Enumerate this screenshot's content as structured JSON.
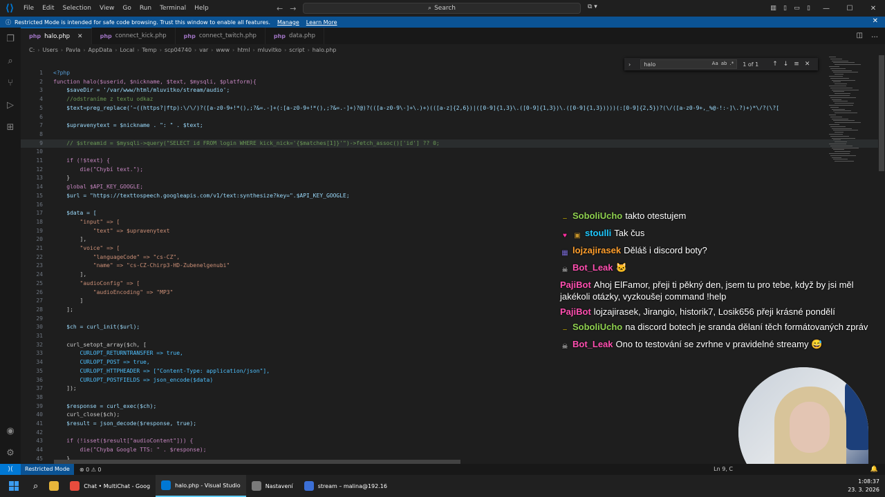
{
  "menu": [
    "File",
    "Edit",
    "Selection",
    "View",
    "Go",
    "Run",
    "Terminal",
    "Help"
  ],
  "search": {
    "label": "Search"
  },
  "banner": {
    "text": "Restricted Mode is intended for safe code browsing. Trust this window to enable all features.",
    "manage": "Manage",
    "learn_more": "Learn More"
  },
  "tabs": [
    {
      "label": "halo.php",
      "active": true
    },
    {
      "label": "connect_kick.php",
      "active": false
    },
    {
      "label": "connect_twitch.php",
      "active": false
    },
    {
      "label": "data.php",
      "active": false
    }
  ],
  "breadcrumb": [
    "C:",
    "Users",
    "Pavla",
    "AppData",
    "Local",
    "Temp",
    "scp04740",
    "var",
    "www",
    "html",
    "mluvitko",
    "script",
    "halo.php"
  ],
  "find": {
    "query": "halo",
    "count": "1 of 1",
    "opt_case": "Aa",
    "opt_word": "ab",
    "opt_regex": ".*"
  },
  "code_lines": [
    {
      "num": "1",
      "text": "<?php"
    },
    {
      "num": "2",
      "text": "function halo($userid, $nickname, $text, $mysqli, $platform){"
    },
    {
      "num": "3",
      "text": "    $saveDir = '/var/www/html/mluvitko/stream/audio';"
    },
    {
      "num": "4",
      "text": "    //odstraníme z textu odkaz"
    },
    {
      "num": "5",
      "text": "    $text=preg_replace('~((https?|ftp):\\/\\/)?([a-z0-9+!*(),;?&=.-]+(:[a-z0-9+!*(),;?&=.-]+)?@)?(([a-z0-9\\-]+\\.)+)(([a-z]{2,6})|([0-9]{1,3}\\.([0-9]{1,3})\\.([0-9]{1,3}))))(:[0-9]{2,5})?(\\/([a-z0-9+,_%@-!:-]\\.?)+)*\\/?(\\?["
    },
    {
      "num": "6",
      "text": ""
    },
    {
      "num": "7",
      "text": "    $upravenytext = $nickname . \": \" . $text;"
    },
    {
      "num": "8",
      "text": ""
    },
    {
      "num": "9",
      "text": "    // $streamid = $mysqli->query(\"SELECT id FROM login WHERE kick_nick='{$matches[1]}'\")->fetch_assoc()['id'] ?? 0;"
    },
    {
      "num": "10",
      "text": ""
    },
    {
      "num": "11",
      "text": "    if (!$text) {"
    },
    {
      "num": "12",
      "text": "        die(\"Chybí text.\");"
    },
    {
      "num": "13",
      "text": "    }"
    },
    {
      "num": "14",
      "text": "    global $API_KEY_GOOGLE;"
    },
    {
      "num": "15",
      "text": "    $url = \"https://texttospeech.googleapis.com/v1/text:synthesize?key=\".$API_KEY_GOOGLE;"
    },
    {
      "num": "16",
      "text": ""
    },
    {
      "num": "17",
      "text": "    $data = ["
    },
    {
      "num": "18",
      "text": "        \"input\" => ["
    },
    {
      "num": "19",
      "text": "            \"text\" => $upravenytext"
    },
    {
      "num": "20",
      "text": "        ],"
    },
    {
      "num": "21",
      "text": "        \"voice\" => ["
    },
    {
      "num": "22",
      "text": "            \"languageCode\" => \"cs-CZ\","
    },
    {
      "num": "23",
      "text": "            \"name\" => \"cs-CZ-Chirp3-HD-Zubenelgenubi\""
    },
    {
      "num": "24",
      "text": "        ],"
    },
    {
      "num": "25",
      "text": "        \"audioConfig\" => ["
    },
    {
      "num": "26",
      "text": "            \"audioEncoding\" => \"MP3\""
    },
    {
      "num": "27",
      "text": "        ]"
    },
    {
      "num": "28",
      "text": "    ];"
    },
    {
      "num": "29",
      "text": ""
    },
    {
      "num": "30",
      "text": "    $ch = curl_init($url);"
    },
    {
      "num": "31",
      "text": ""
    },
    {
      "num": "32",
      "text": "    curl_setopt_array($ch, ["
    },
    {
      "num": "33",
      "text": "        CURLOPT_RETURNTRANSFER => true,"
    },
    {
      "num": "34",
      "text": "        CURLOPT_POST => true,"
    },
    {
      "num": "35",
      "text": "        CURLOPT_HTTPHEADER => [\"Content-Type: application/json\"],"
    },
    {
      "num": "36",
      "text": "        CURLOPT_POSTFIELDS => json_encode($data)"
    },
    {
      "num": "37",
      "text": "    ]);"
    },
    {
      "num": "38",
      "text": ""
    },
    {
      "num": "39",
      "text": "    $response = curl_exec($ch);"
    },
    {
      "num": "40",
      "text": "    curl_close($ch);"
    },
    {
      "num": "41",
      "text": "    $result = json_decode($response, true);"
    },
    {
      "num": "42",
      "text": ""
    },
    {
      "num": "43",
      "text": "    if (!isset($result[\"audioContent\"])) {"
    },
    {
      "num": "44",
      "text": "        die(\"Chyba Google TTS: \" . $response);"
    },
    {
      "num": "45",
      "text": "    }"
    }
  ],
  "chat": [
    {
      "user": "SoboliUcho",
      "color": "#8fd14f",
      "badge": "‒",
      "badge_color": "#d4b800",
      "text": "takto otestujem"
    },
    {
      "user": "stoulli",
      "color": "#1ec8ff",
      "badge": "♥",
      "badge_color": "#ff2fa0",
      "badge2": "▣",
      "badge2_color": "#c5932a",
      "text": "Tak čus"
    },
    {
      "user": "lojzajirasek",
      "color": "#ff9e2c",
      "badge": "▦",
      "badge_color": "#7a6bd6",
      "text": "Děláš i discord boty?"
    },
    {
      "user": "Bot_Leak",
      "color": "#ff4fb0",
      "badge": "☠",
      "badge_color": "#eeeeee",
      "text": "🐱"
    },
    {
      "user": "PajiBot",
      "color": "#ff4fb0",
      "text": "Ahoj ElFamor, přeji ti pěkný den, jsem tu pro tebe, když by jsi měl jakékoli otázky, vyzkoušej command !help"
    },
    {
      "user": "PajiBot",
      "color": "#ff4fb0",
      "text": "lojzajirasek, Jirangio, historik7, Losik656 přeji krásné pondělí"
    },
    {
      "user": "SoboliUcho",
      "color": "#8fd14f",
      "badge": "‒",
      "badge_color": "#d4b800",
      "text": "na discord botech je sranda dělaní těch formátovaných zpráv"
    },
    {
      "user": "Bot_Leak",
      "color": "#ff4fb0",
      "badge": "☠",
      "badge_color": "#eeeeee",
      "text": "Ono to testování se zvrhne v pravidelné streamy 😅"
    }
  ],
  "status": {
    "restricted": "Restricted Mode",
    "errors": "0",
    "warnings": "0",
    "position": "Ln 9, C"
  },
  "taskbar": {
    "apps": [
      {
        "label": "Chat • MultiChat - Goog",
        "icon": "chrome-icon"
      },
      {
        "label": "halo.php - Visual Studio",
        "icon": "vscode-icon",
        "active": true
      },
      {
        "label": "Nastavení",
        "icon": "settings-icon"
      },
      {
        "label": "stream – malina@192.16",
        "icon": "remote-desktop-icon"
      }
    ],
    "time": "1:08:37",
    "date": "23. 3. 2026"
  }
}
